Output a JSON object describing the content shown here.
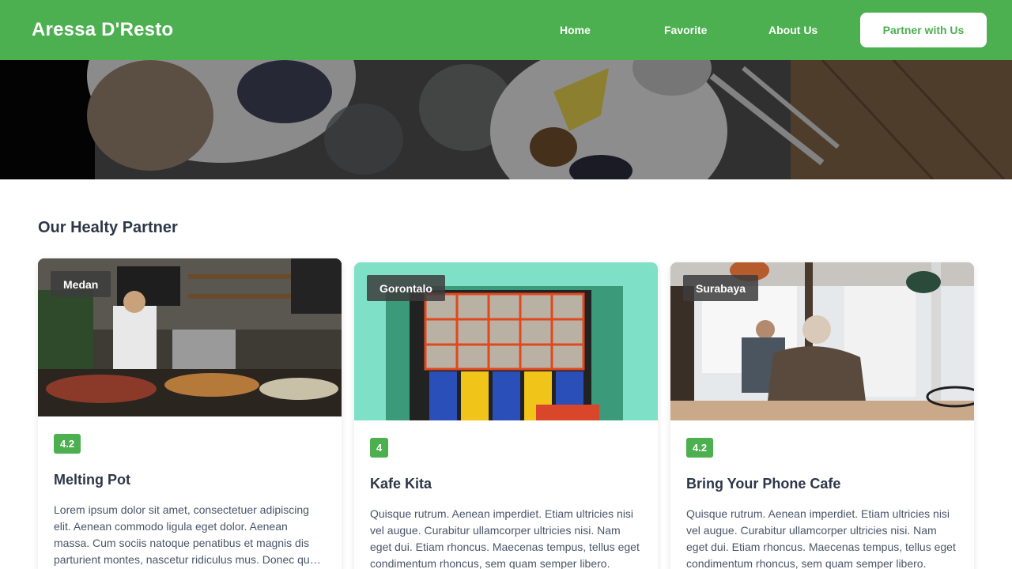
{
  "header": {
    "brand": "Aressa D'Resto",
    "nav": {
      "home": "Home",
      "favorite": "Favorite",
      "about": "About Us"
    },
    "cta": "Partner with Us"
  },
  "colors": {
    "primary": "#4caf50",
    "text": "#2d3748"
  },
  "section": {
    "title": "Our Healty Partner"
  },
  "restaurants": [
    {
      "city": "Medan",
      "rating": "4.2",
      "name": "Melting Pot",
      "description": "Lorem ipsum dolor sit amet, consectetuer adipiscing elit. Aenean commodo ligula eget dolor. Aenean massa. Cum sociis natoque penatibus et magnis dis parturient montes, nascetur ridiculus mus. Donec quam felis, ultricies nec."
    },
    {
      "city": "Gorontalo",
      "rating": "4",
      "name": "Kafe Kita",
      "description": "Quisque rutrum. Aenean imperdiet. Etiam ultricies nisi vel augue. Curabitur ullamcorper ultricies nisi. Nam eget dui. Etiam rhoncus. Maecenas tempus, tellus eget condimentum rhoncus, sem quam semper libero."
    },
    {
      "city": "Surabaya",
      "rating": "4.2",
      "name": "Bring Your Phone Cafe",
      "description": "Quisque rutrum. Aenean imperdiet. Etiam ultricies nisi vel augue. Curabitur ullamcorper ultricies nisi. Nam eget dui. Etiam rhoncus. Maecenas tempus, tellus eget condimentum rhoncus, sem quam semper libero."
    }
  ]
}
